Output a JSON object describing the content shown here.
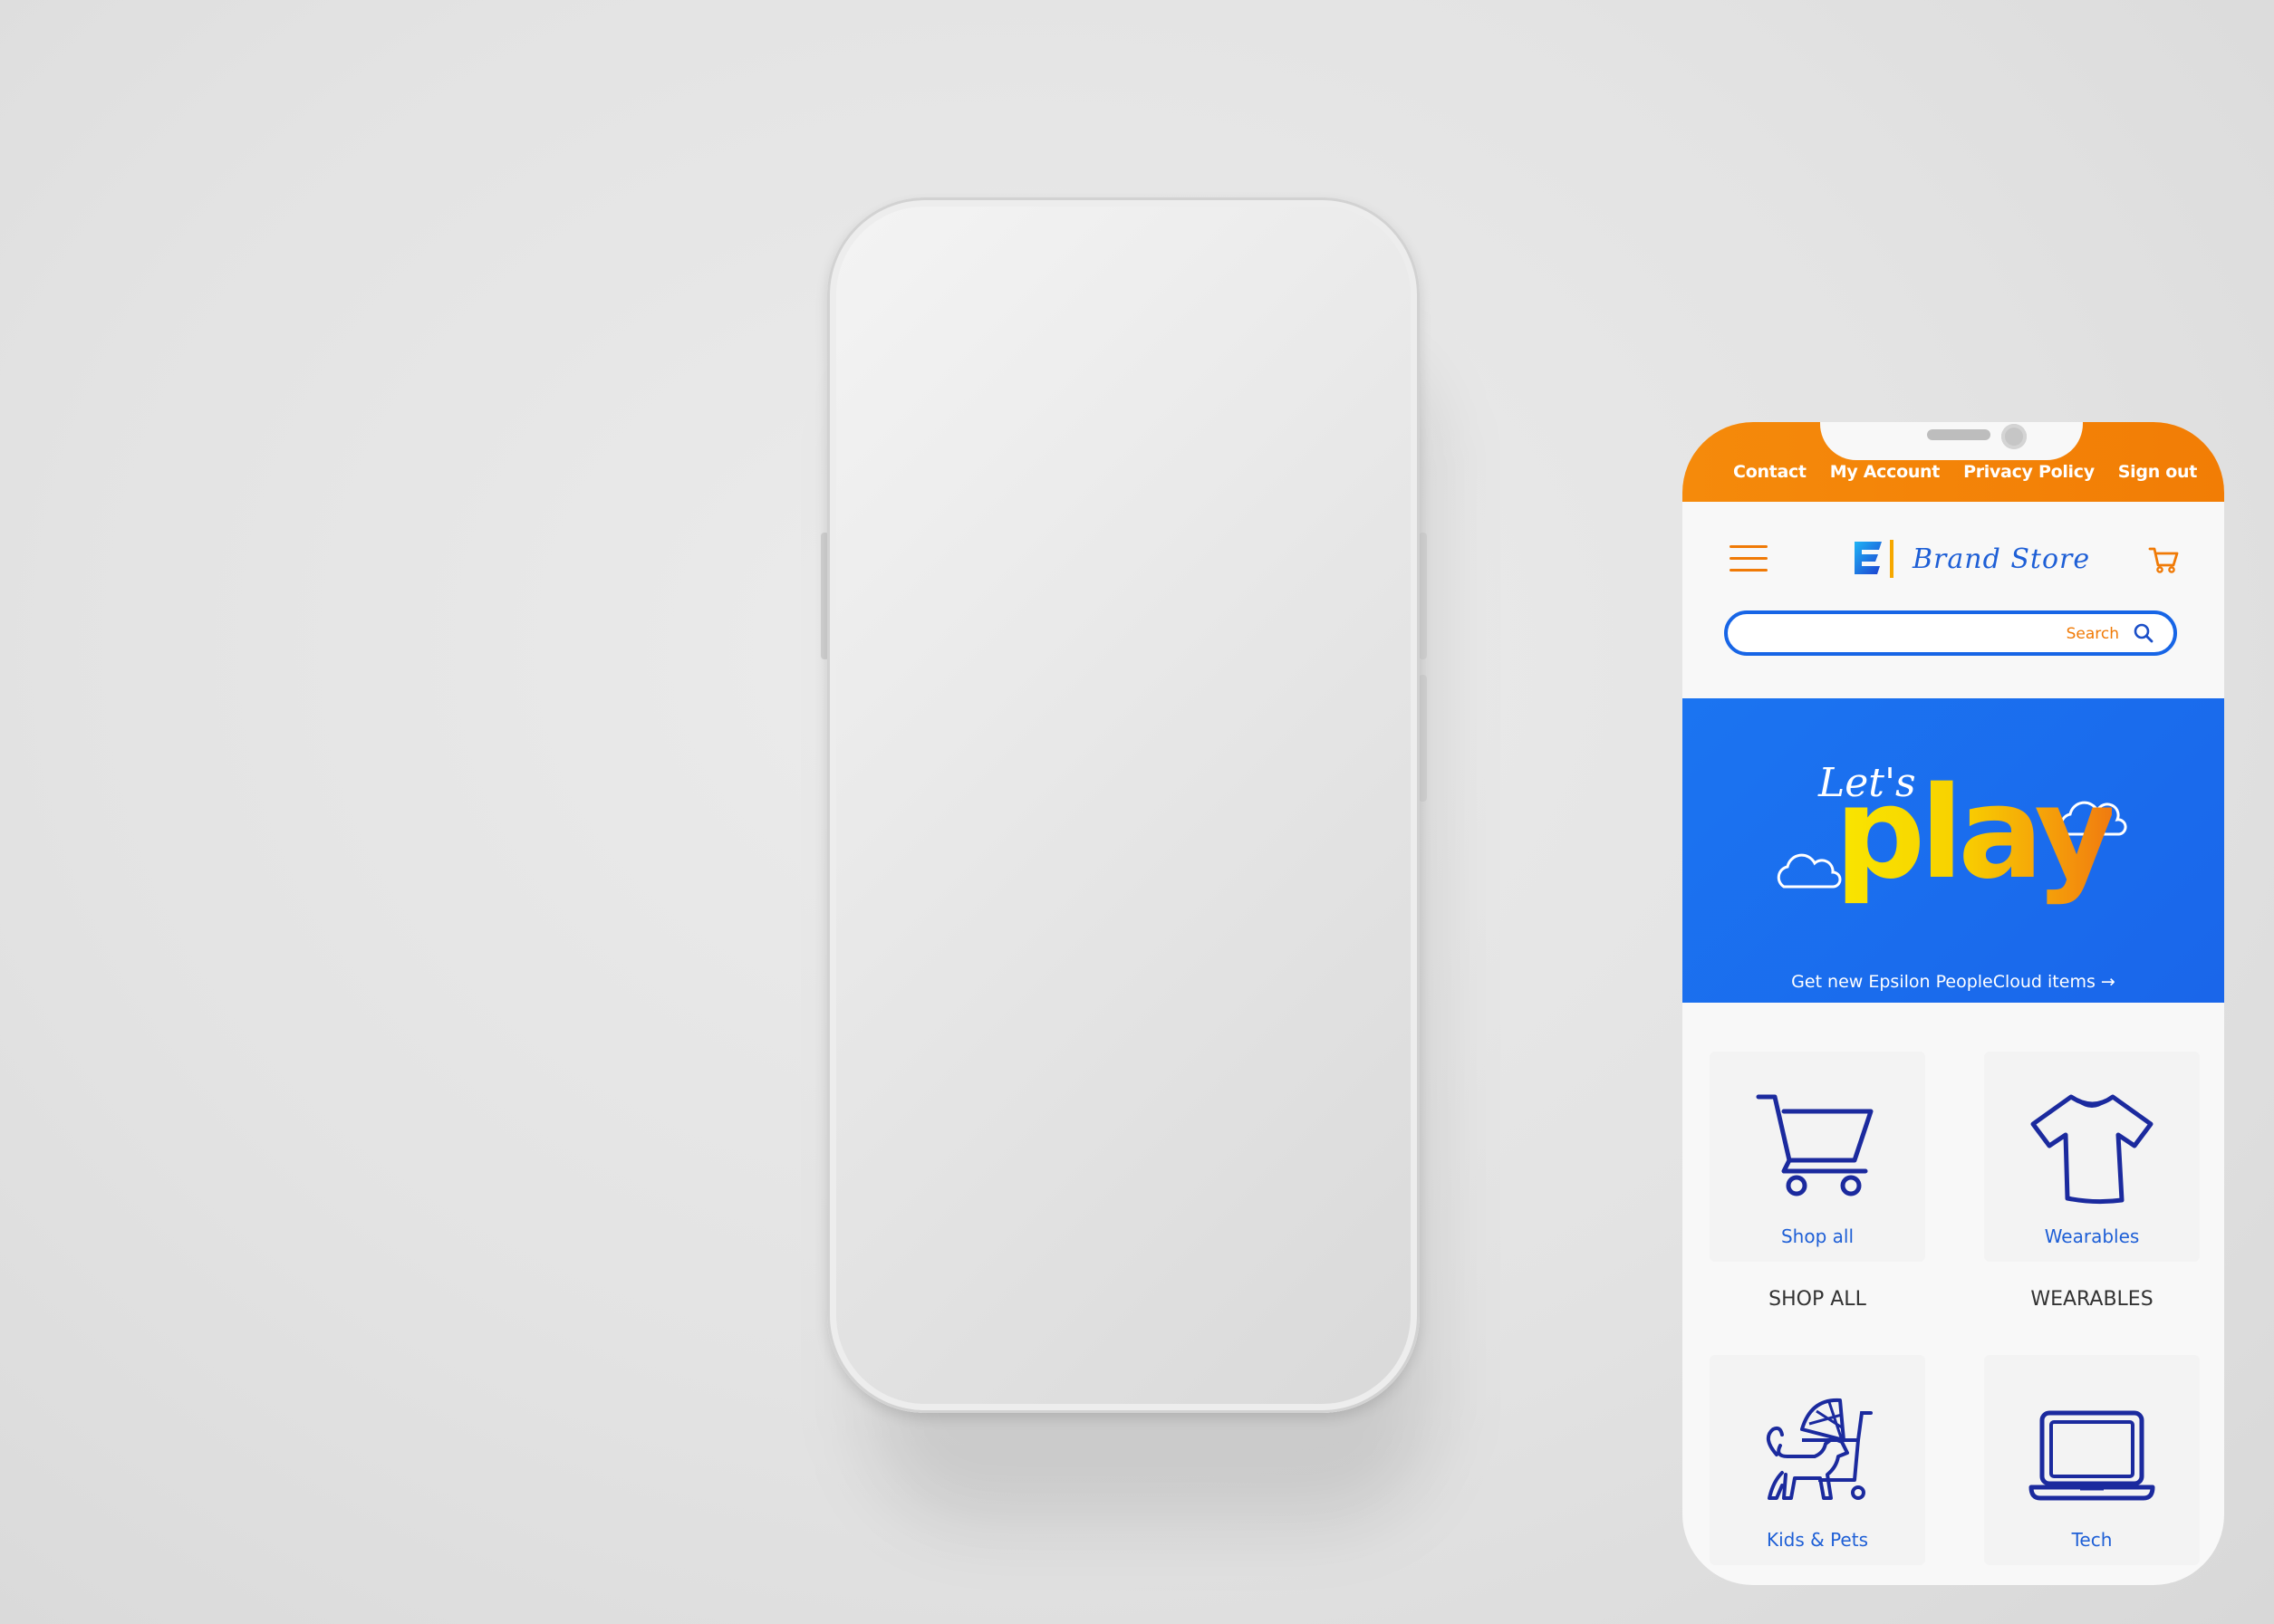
{
  "top_nav": {
    "links": [
      "Contact",
      "My Account",
      "Privacy Policy",
      "Sign out"
    ]
  },
  "header": {
    "logo_text": "Brand Store",
    "logo_letter": "E"
  },
  "search": {
    "placeholder": "Search"
  },
  "hero": {
    "lets": "Let's",
    "play": "play",
    "cta": "Get new Epsilon PeopleCloud items →"
  },
  "categories": [
    {
      "label": "Shop all",
      "caption": "SHOP ALL",
      "icon": "cart-icon"
    },
    {
      "label": "Wearables",
      "caption": "WEARABLES",
      "icon": "tshirt-icon"
    },
    {
      "label": "Kids & Pets",
      "icon": "stroller-dog-icon"
    },
    {
      "label": "Tech",
      "icon": "laptop-icon"
    }
  ],
  "colors": {
    "orange": "#f27d05",
    "blue": "#1a6aeb",
    "navy": "#1b2a9e",
    "yellow": "#f8d100"
  }
}
